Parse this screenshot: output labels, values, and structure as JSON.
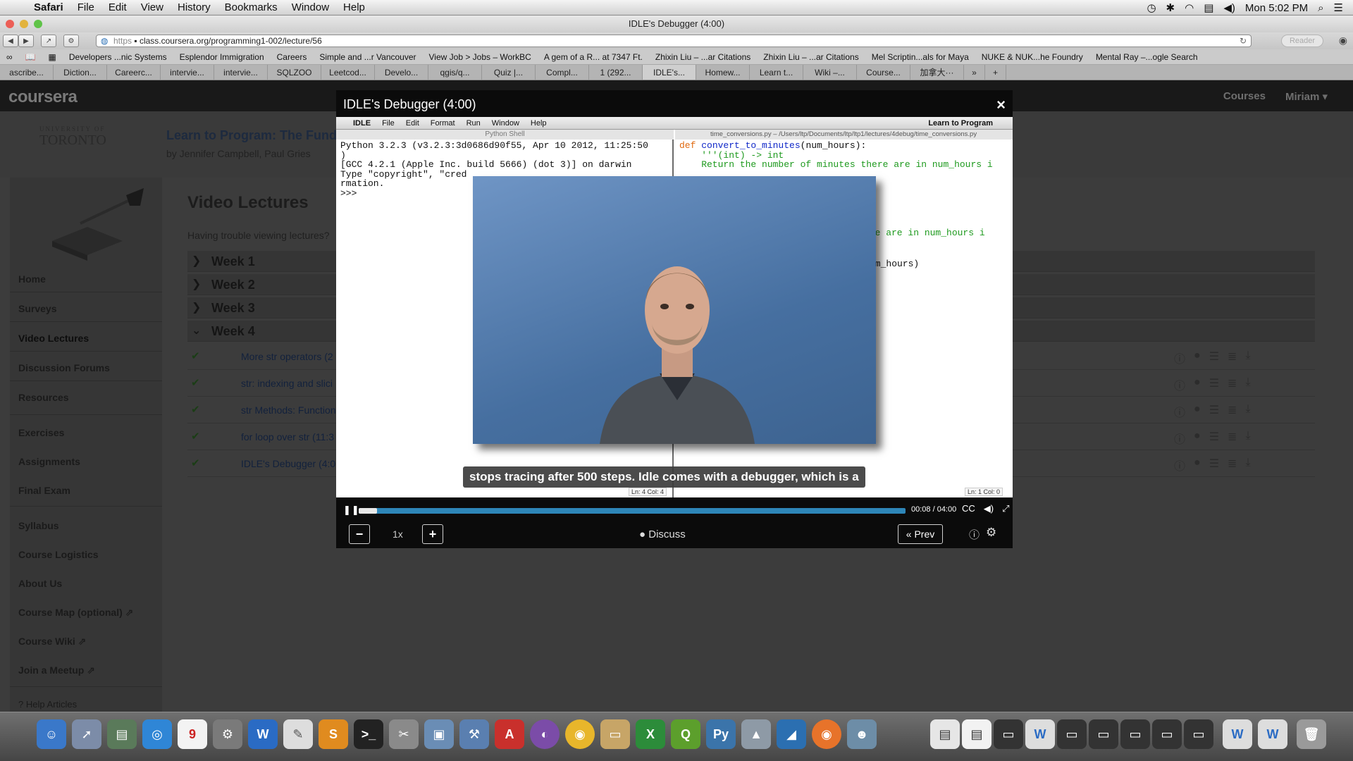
{
  "menubar": {
    "app": "Safari",
    "items": [
      "File",
      "Edit",
      "View",
      "History",
      "Bookmarks",
      "Window",
      "Help"
    ],
    "clock": "Mon 5:02 PM"
  },
  "window": {
    "title": "IDLE's Debugger (4:00)"
  },
  "address": {
    "protocol": "https",
    "url": "class.coursera.org/programming1-002/lecture/56",
    "reader": "Reader"
  },
  "bookmarks": [
    "Developers ...nic Systems",
    "Esplendor Immigration",
    "Careers",
    "Simple and ...r Vancouver",
    "View Job > Jobs – WorkBC",
    "A gem of a R... at 7347 Ft.",
    "Zhixin Liu – ...ar Citations",
    "Zhixin Liu – ...ar Citations",
    "Mel Scriptin...als for Maya",
    "NUKE & NUK...he Foundry",
    "Mental Ray –...ogle Search"
  ],
  "tabs": [
    "ascribe...",
    "Diction...",
    "Careerc...",
    "intervie...",
    "intervie...",
    "SQLZOO",
    "Leetcod...",
    "Develo...",
    "qgis/q...",
    "Quiz |...",
    "Compl...",
    "1 (292...",
    "IDLE's...",
    "Homew...",
    "Learn t...",
    "Wiki –...",
    "Course...",
    "加拿大···"
  ],
  "coursera": {
    "logo": "coursera",
    "nav": [
      "Courses",
      "Miriam ▾"
    ],
    "university_small": "UNIVERSITY OF",
    "university": "TORONTO",
    "course_title": "Learn to Program: The Fund",
    "authors": "by Jennifer Campbell, Paul Gries"
  },
  "sidebar": {
    "items": [
      "Home",
      "Surveys",
      "Video Lectures",
      "Discussion Forums",
      "Resources",
      "Exercises",
      "Assignments",
      "Final Exam",
      "Syllabus",
      "Course Logistics",
      "About Us",
      "Course Map (optional)",
      "Course Wiki",
      "Join a Meetup",
      "Help Articles"
    ]
  },
  "main": {
    "heading": "Video Lectures",
    "trouble": "Having trouble viewing lectures?",
    "weeks": [
      "Week 1",
      "Week 2",
      "Week 3",
      "Week 4"
    ],
    "lectures": [
      "More str operators (2",
      "str: indexing and slici",
      "str Methods: Function",
      "for loop over str (11:3",
      "IDLE's Debugger (4:0"
    ]
  },
  "modal": {
    "title": "IDLE's Debugger (4:00)",
    "close": "×",
    "idle_menu": {
      "items": [
        "IDLE",
        "File",
        "Edit",
        "Format",
        "Run",
        "Window",
        "Help"
      ],
      "right": "Learn to Program"
    },
    "shell_title": "Python Shell",
    "shell_lines": [
      "Python 3.2.3 (v3.2.3:3d0686d90f55, Apr 10 2012, 11:25:50",
      ")",
      "[GCC 4.2.1 (Apple Inc. build 5666) (dot 3)] on darwin",
      "Type \"copyright\", \"cred",
      "rmation.",
      ">>>"
    ],
    "shell_status": "Ln: 4 Col: 4",
    "editor_title": "time_conversions.py – /Users/ltp/Documents/ltp/ltp1/lectures/4debug/time_conversions.py",
    "code": {
      "kw": "def",
      "fname": "convert_to_minutes",
      "sig": "(num_hours):",
      "doc1": "    '''(int) -> int",
      "doc2": "    Return the number of minutes there are in num_hours i",
      "doc3": "ere are in num_hours i",
      "tail": "um_hours)"
    },
    "editor_status": "Ln: 1 Col: 0",
    "caption": "stops tracing after 500 steps. Idle comes with a debugger, which is a",
    "progress": 0.033,
    "time": "00:08 / 04:00",
    "speed": "1x",
    "discuss": "Discuss",
    "prev": "« Prev"
  },
  "colors": {
    "accent": "#2e86b8",
    "modal_bg": "#0b0b0b",
    "overlay": "#3c3c3c"
  }
}
